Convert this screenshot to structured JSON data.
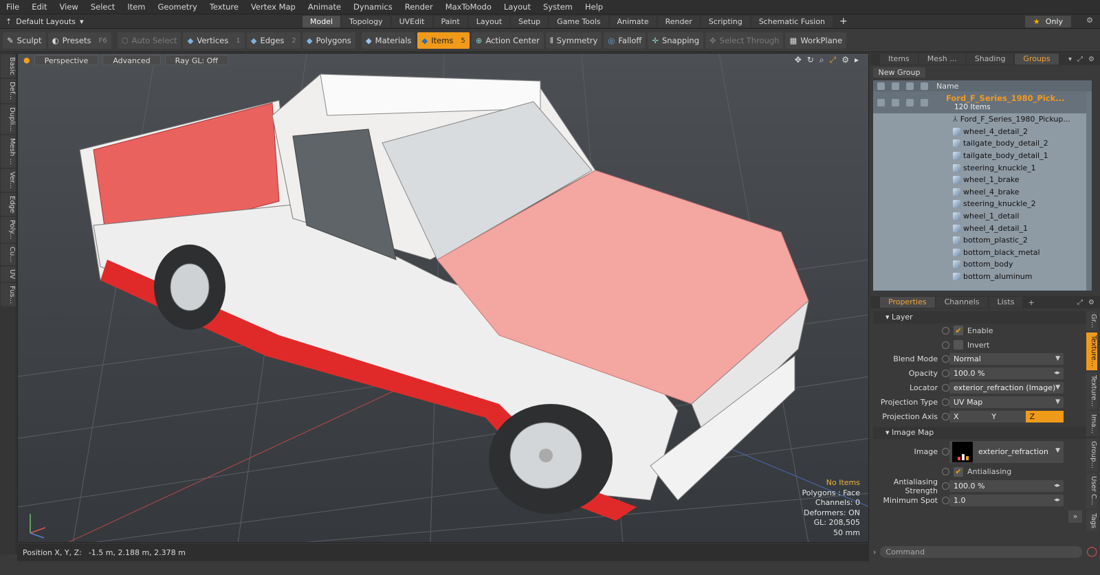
{
  "menu": [
    "File",
    "Edit",
    "View",
    "Select",
    "Item",
    "Geometry",
    "Texture",
    "Vertex Map",
    "Animate",
    "Dynamics",
    "Render",
    "MaxToModo",
    "Layout",
    "System",
    "Help"
  ],
  "layout_selector": "Default Layouts",
  "tabs": [
    {
      "label": "Model",
      "active": true
    },
    {
      "label": "Topology"
    },
    {
      "label": "UVEdit"
    },
    {
      "label": "Paint"
    },
    {
      "label": "Layout"
    },
    {
      "label": "Setup"
    },
    {
      "label": "Game Tools"
    },
    {
      "label": "Animate"
    },
    {
      "label": "Render"
    },
    {
      "label": "Scripting"
    },
    {
      "label": "Schematic Fusion"
    }
  ],
  "only_label": "Only",
  "toolbar": {
    "sculpt": "Sculpt",
    "presets": "Presets",
    "presets_key": "F6",
    "auto_select": "Auto Select",
    "vertices": "Vertices",
    "vertices_key": "1",
    "edges": "Edges",
    "edges_key": "2",
    "polygons": "Polygons",
    "materials": "Materials",
    "items": "Items",
    "items_key": "5",
    "action_center": "Action Center",
    "symmetry": "Symmetry",
    "falloff": "Falloff",
    "snapping": "Snapping",
    "select_through": "Select Through",
    "workplane": "WorkPlane"
  },
  "left_tabs": [
    "Basic",
    "Def...",
    "Dupli...",
    "Mesh ...",
    "Ver...",
    "Edge",
    "Poly...",
    "Cu...",
    "UV",
    "Fus..."
  ],
  "viewport": {
    "mode": "Perspective",
    "advanced": "Advanced",
    "raygl": "Ray GL: Off",
    "stats": {
      "no_items": "No Items",
      "polygons": "Polygons : Face",
      "channels": "Channels: 0",
      "deformers": "Deformers: ON",
      "gl": "GL: 208,505",
      "focal": "50 mm"
    }
  },
  "status": {
    "label": "Position X, Y, Z:",
    "value": "-1.5 m, 2.188 m, 2.378 m"
  },
  "right_tabs": [
    {
      "label": "Items"
    },
    {
      "label": "Mesh ..."
    },
    {
      "label": "Shading"
    },
    {
      "label": "Groups",
      "active": true
    }
  ],
  "new_group": "New Group",
  "tree": {
    "name_col": "Name",
    "group_name": "Ford_F_Series_1980_Pick...",
    "group_count": "120 Items",
    "items": [
      "Ford_F_Series_1980_Pickup...",
      "wheel_4_detail_2",
      "tailgate_body_detail_2",
      "tailgate_body_detail_1",
      "steering_knuckle_1",
      "wheel_1_brake",
      "wheel_4_brake",
      "steering_knuckle_2",
      "wheel_1_detail",
      "wheel_4_detail_1",
      "bottom_plastic_2",
      "bottom_black_metal",
      "bottom_body",
      "bottom_aluminum"
    ]
  },
  "prop_tabs": [
    {
      "label": "Properties",
      "active": true
    },
    {
      "label": "Channels"
    },
    {
      "label": "Lists"
    }
  ],
  "props": {
    "layer": "Layer",
    "enable": "Enable",
    "invert": "Invert",
    "blend_mode_l": "Blend Mode",
    "blend_mode": "Normal",
    "opacity_l": "Opacity",
    "opacity": "100.0 %",
    "locator_l": "Locator",
    "locator": "exterior_refraction (Image) (...",
    "proj_type_l": "Projection Type",
    "proj_type": "UV Map",
    "proj_axis_l": "Projection Axis",
    "axis_x": "X",
    "axis_y": "Y",
    "axis_z": "Z",
    "image_map": "Image Map",
    "image_l": "Image",
    "image": "exterior_refraction",
    "antialiasing": "Antialiasing",
    "aa_strength_l": "Antialiasing Strength",
    "aa_strength": "100.0 %",
    "min_spot_l": "Minimum Spot",
    "min_spot": "1.0"
  },
  "right_vtabs": [
    {
      "label": "Gr..."
    },
    {
      "label": "Texture...",
      "active": true
    },
    {
      "label": "Texture..."
    },
    {
      "label": "Ima..."
    },
    {
      "label": "Group..."
    },
    {
      "label": "User C..."
    },
    {
      "label": "Tags"
    }
  ],
  "command_placeholder": "Command",
  "colors": {
    "accent": "#f09a1a",
    "truck_red": "#e83a3a",
    "truck_pink": "#f4a6a0"
  }
}
